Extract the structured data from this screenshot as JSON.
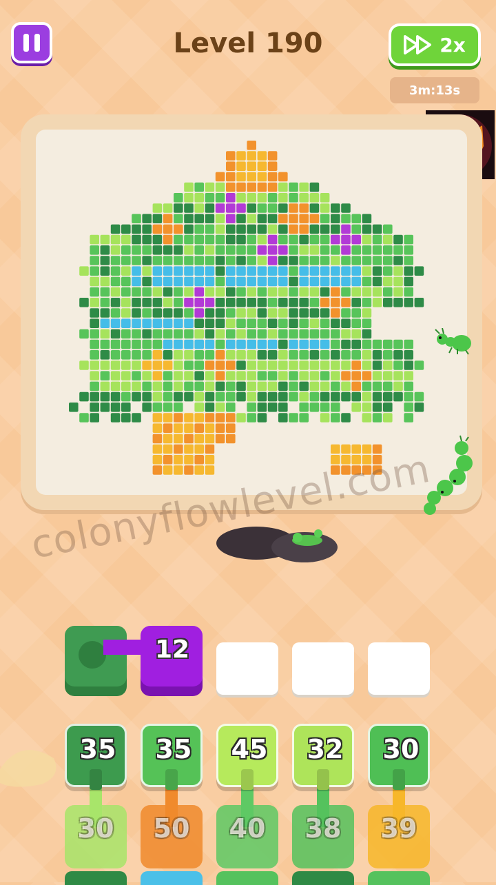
{
  "header": {
    "level_title": "Level 190",
    "speed_label": "2x",
    "timer": "3m:13s"
  },
  "watermark": "colonyflowlevel.com",
  "queue": {
    "active_slot_count": 12,
    "active_slot_color": "#a01fe0",
    "filled_color": "#3a9b4a",
    "empty_slots": 3
  },
  "stacks": [
    {
      "top": {
        "count": "35",
        "color": "#3d9b4e"
      },
      "bottom": {
        "count": "30",
        "color": "#a8e56a"
      }
    },
    {
      "top": {
        "count": "35",
        "color": "#55c257"
      },
      "bottom": {
        "count": "50",
        "color": "#f08a2c"
      }
    },
    {
      "top": {
        "count": "45",
        "color": "#b6ea5c"
      },
      "bottom": {
        "count": "40",
        "color": "#5ec964"
      }
    },
    {
      "top": {
        "count": "32",
        "color": "#aee45a"
      },
      "bottom": {
        "count": "38",
        "color": "#55c25d"
      }
    },
    {
      "top": {
        "count": "30",
        "color": "#4fbf55"
      },
      "bottom": {
        "count": "39",
        "color": "#f7b72a"
      }
    }
  ],
  "palette": {
    "dark_green": "#2e8b47",
    "green": "#57c45a",
    "light_green": "#a6e35c",
    "blue": "#45bde8",
    "orange": "#f2922c",
    "yellow": "#f6b830",
    "purple": "#b23ad6"
  },
  "icons": {
    "pause": "pause-icon",
    "speed": "fast-forward-icon",
    "avatar": "tiger-avatar-icon",
    "ant": "ant-icon"
  }
}
